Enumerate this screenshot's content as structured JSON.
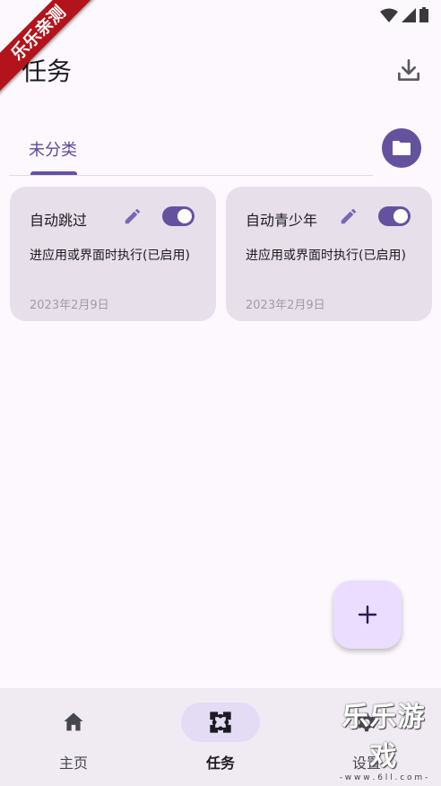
{
  "ribbon": {
    "text": "乐乐亲测"
  },
  "header": {
    "title": "任务"
  },
  "tabs": [
    {
      "label": "未分类"
    }
  ],
  "cards": [
    {
      "title": "自动跳过",
      "description": "进应用或界面时执行(已启用)",
      "date": "2023年2月9日",
      "enabled": true
    },
    {
      "title": "自动青少年",
      "description": "进应用或界面时执行(已启用)",
      "date": "2023年2月9日",
      "enabled": true
    }
  ],
  "nav": {
    "home": "主页",
    "tasks": "任务",
    "settings": "设置"
  },
  "watermark": {
    "text": "乐乐游戏",
    "url": "- w w w . 6 l l . c o m -"
  },
  "colors": {
    "accent": "#65529e",
    "card_bg": "#e7e0eb",
    "fab_bg": "#eaddff",
    "ribbon": "#b3131a"
  },
  "icons": [
    "wifi-icon",
    "signal-icon",
    "battery-icon",
    "download-icon",
    "folder-icon",
    "edit-icon",
    "plus-icon",
    "home-icon",
    "tasks-icon",
    "gear-icon"
  ]
}
